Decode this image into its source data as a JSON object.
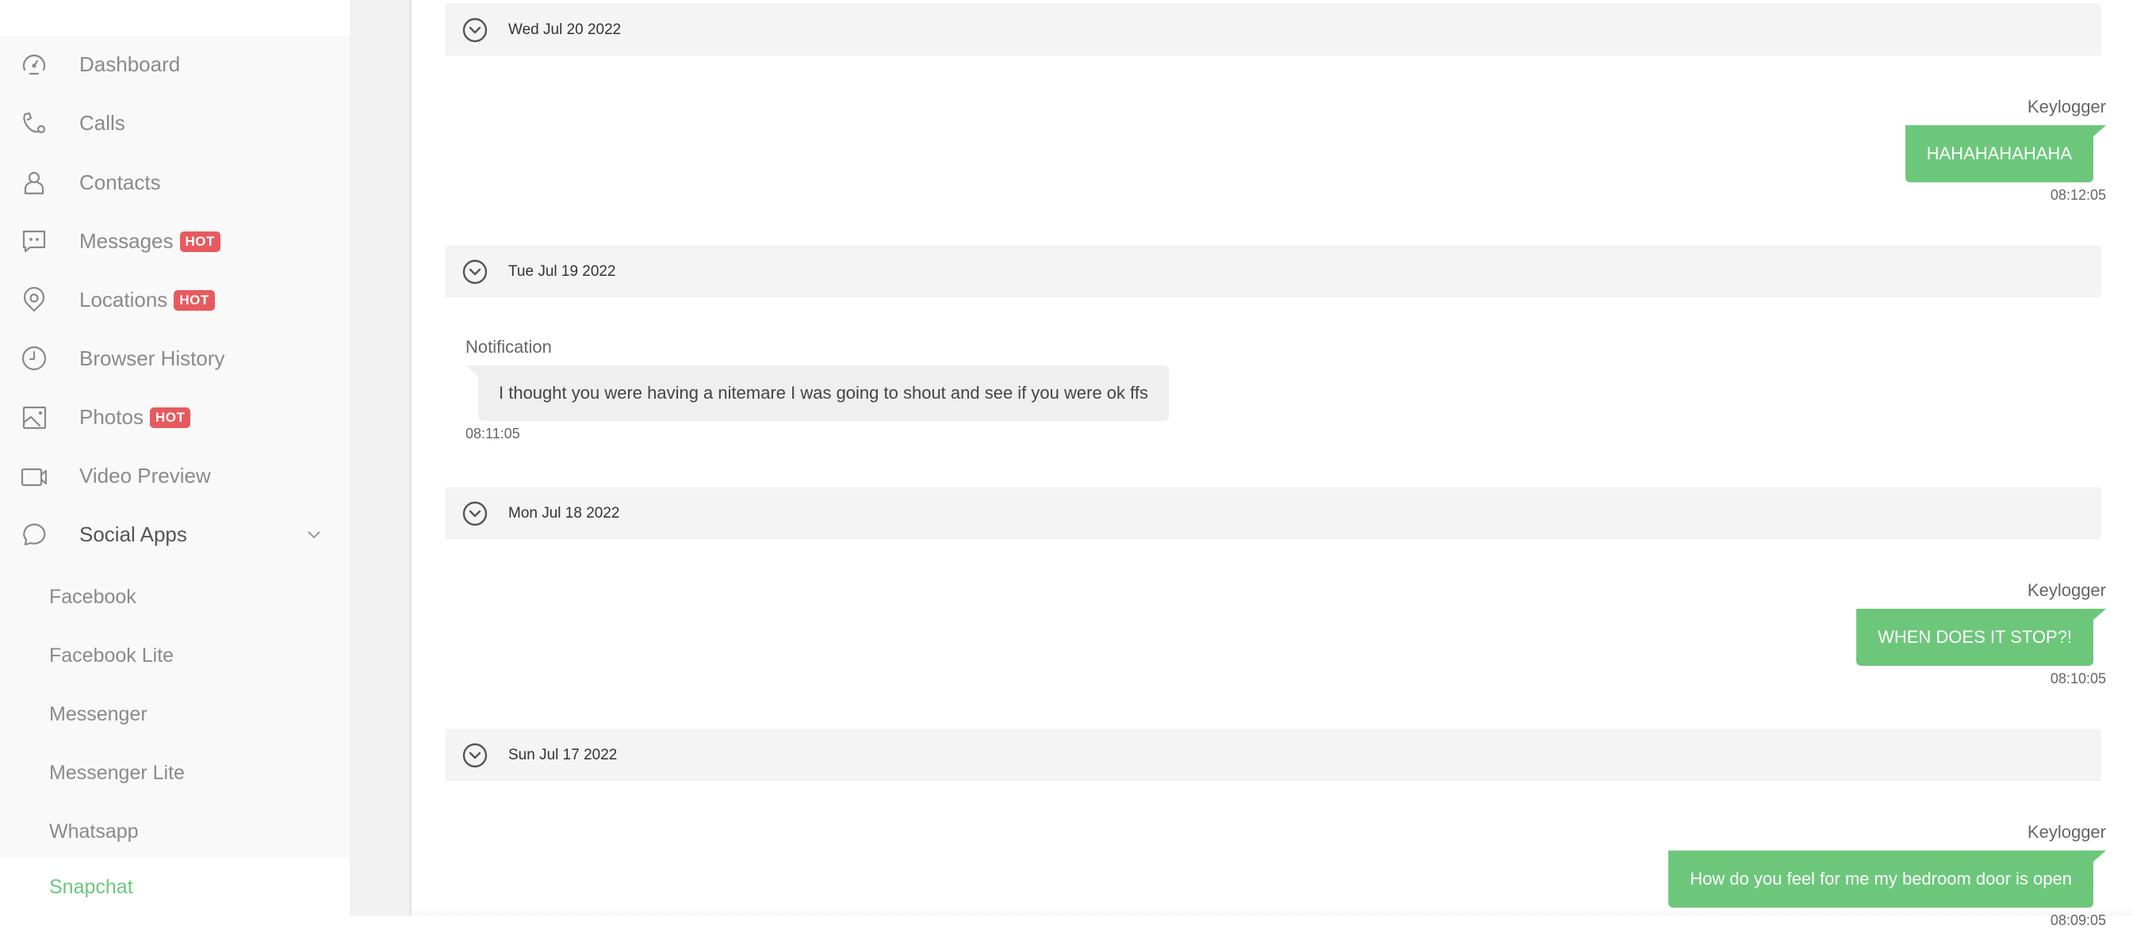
{
  "sidebar": {
    "items": [
      {
        "label": "Dashboard",
        "icon": "dashboard-icon",
        "hot": false
      },
      {
        "label": "Calls",
        "icon": "phone-icon",
        "hot": false
      },
      {
        "label": "Contacts",
        "icon": "user-icon",
        "hot": false
      },
      {
        "label": "Messages",
        "icon": "message-icon",
        "hot": true
      },
      {
        "label": "Locations",
        "icon": "location-pin-icon",
        "hot": true
      },
      {
        "label": "Browser History",
        "icon": "clock-icon",
        "hot": false
      },
      {
        "label": "Photos",
        "icon": "image-icon",
        "hot": true
      },
      {
        "label": "Video Preview",
        "icon": "video-camera-icon",
        "hot": false
      },
      {
        "label": "Social Apps",
        "icon": "chat-bubble-icon",
        "hot": false,
        "expanded": true
      }
    ],
    "hot_label": "HOT",
    "social_apps": [
      {
        "label": "Facebook"
      },
      {
        "label": "Facebook Lite"
      },
      {
        "label": "Messenger"
      },
      {
        "label": "Messenger Lite"
      },
      {
        "label": "Whatsapp"
      },
      {
        "label": "Snapchat",
        "active": true
      }
    ]
  },
  "colors": {
    "accent_green": "#6cc77b",
    "hot_badge": "#e65a5f",
    "incoming_bubble": "#efefef",
    "date_header_bg": "#f4f4f4"
  },
  "conversation": [
    {
      "date": "Wed Jul 20 2022",
      "messages": [
        {
          "direction": "out",
          "sender": "Keylogger",
          "text": "HAHAHAHAHAHA",
          "time": "08:12:05"
        }
      ]
    },
    {
      "date": "Tue Jul 19 2022",
      "messages": [
        {
          "direction": "in",
          "sender": "Notification",
          "text": "I thought you were having a nitemare I was going to shout and see if you were ok ffs",
          "time": "08:11:05"
        }
      ]
    },
    {
      "date": "Mon Jul 18 2022",
      "messages": [
        {
          "direction": "out",
          "sender": "Keylogger",
          "text": "WHEN DOES IT STOP?!",
          "time": "08:10:05"
        }
      ]
    },
    {
      "date": "Sun Jul 17 2022",
      "messages": [
        {
          "direction": "out",
          "sender": "Keylogger",
          "text": "How do you feel for me my bedroom door is open",
          "time": "08:09:05"
        }
      ]
    }
  ]
}
